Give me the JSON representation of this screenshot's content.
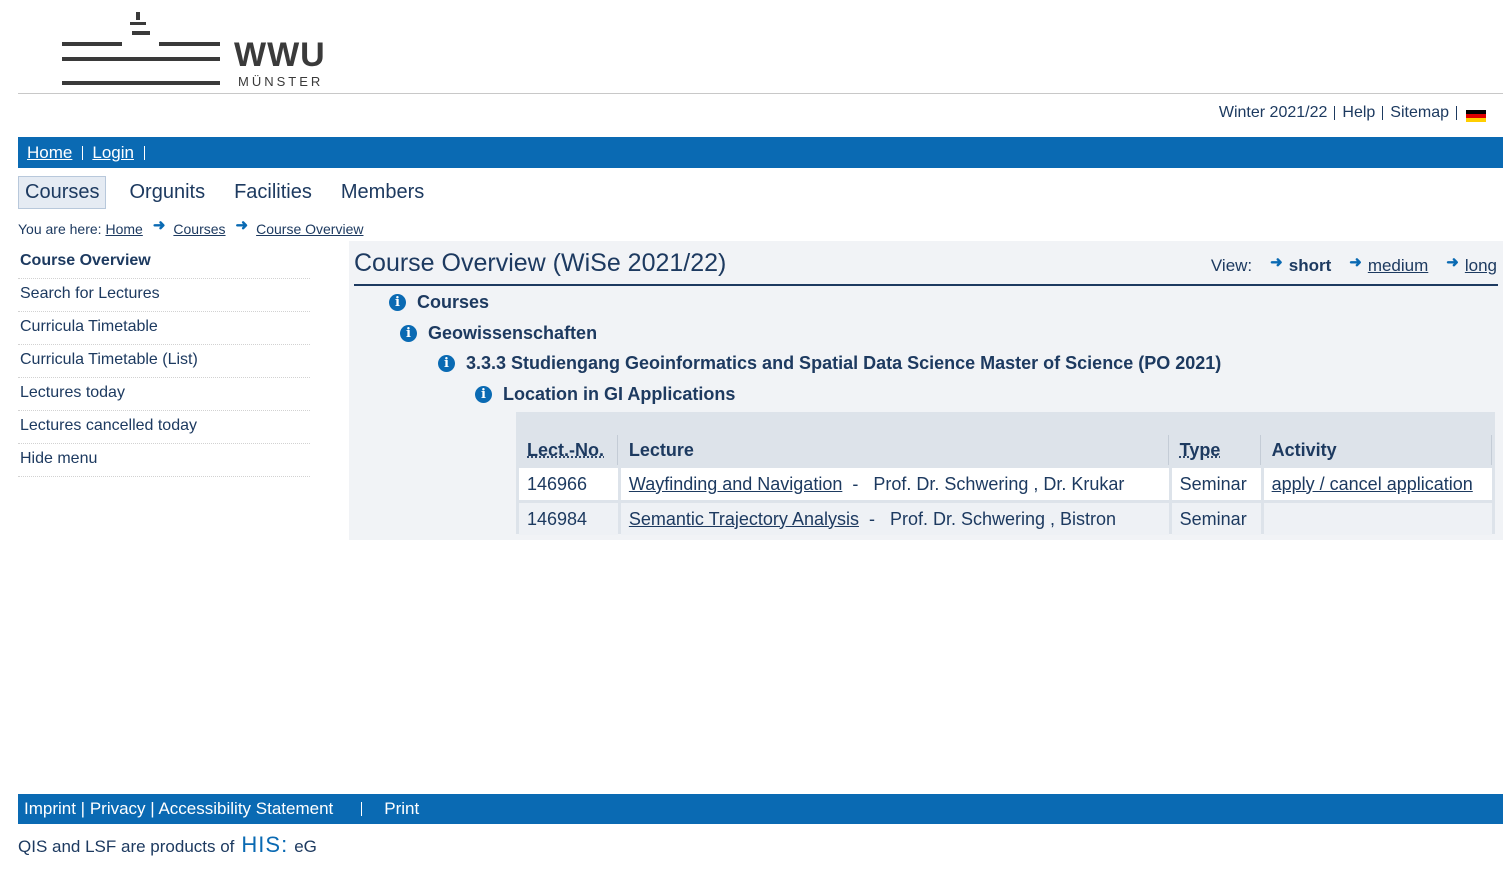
{
  "brand": {
    "name": "WWU",
    "city": "MÜNSTER"
  },
  "toplinks": {
    "semester": "Winter 2021/22",
    "help": "Help",
    "sitemap": "Sitemap",
    "language_flag": "german-flag-icon"
  },
  "navbar": {
    "home": "Home",
    "login": "Login"
  },
  "tabs": [
    {
      "label": "Courses",
      "active": true
    },
    {
      "label": "Orgunits"
    },
    {
      "label": "Facilities"
    },
    {
      "label": "Members"
    }
  ],
  "breadcrumb": {
    "prefix": "You are here:",
    "items": [
      "Home",
      "Courses",
      "Course Overview"
    ]
  },
  "leftmenu": {
    "items": [
      {
        "label": "Course Overview",
        "active": true
      },
      {
        "label": "Search for Lectures"
      },
      {
        "label": "Curricula Timetable"
      },
      {
        "label": "Curricula Timetable (List)"
      },
      {
        "label": "Lectures today"
      },
      {
        "label": "Lectures cancelled today"
      },
      {
        "label": "Hide menu"
      }
    ]
  },
  "main": {
    "title": "Course Overview (WiSe 2021/22)",
    "view": {
      "label": "View:",
      "short": "short",
      "medium": "medium",
      "long": "long"
    },
    "tree": [
      "Courses",
      "Geowissenschaften",
      "3.3.3 Studiengang Geoinformatics and Spatial Data Science Master of Science (PO 2021)",
      "Location in GI Applications"
    ],
    "table": {
      "headers": {
        "no": "Lect.-No.",
        "lecture": "Lecture",
        "type": "Type",
        "activity": "Activity"
      },
      "rows": [
        {
          "no": "146966",
          "title": "Wayfinding and Navigation",
          "lecturers": "Prof. Dr. Schwering ,  Dr. Krukar",
          "type": "Seminar",
          "activity": "apply / cancel application"
        },
        {
          "no": "146984",
          "title": "Semantic Trajectory Analysis",
          "lecturers": "Prof. Dr. Schwering ,  Bistron",
          "type": "Seminar",
          "activity": ""
        }
      ]
    }
  },
  "footer": {
    "links": "Imprint | Privacy | Accessibility Statement",
    "print": "Print"
  },
  "credits": {
    "prefix": "QIS and LSF are products of",
    "his": "HIS:",
    "suffix": "eG"
  }
}
